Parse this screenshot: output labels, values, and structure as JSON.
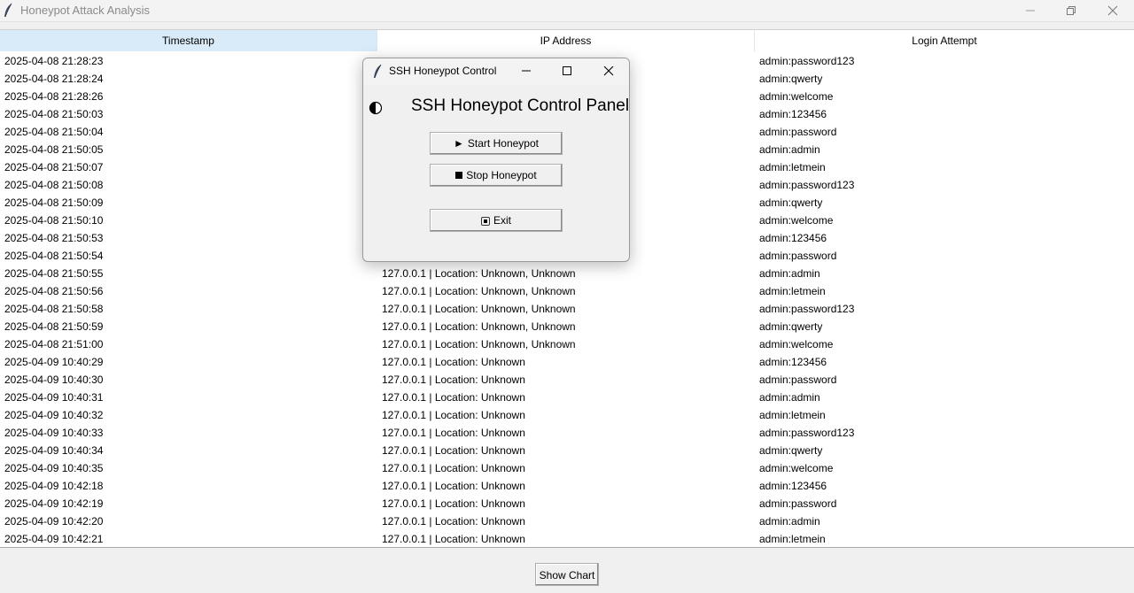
{
  "window": {
    "title": "Honeypot Attack Analysis"
  },
  "table": {
    "columns": [
      "Timestamp",
      "IP Address",
      "Login Attempt"
    ],
    "rows": [
      [
        "2025-04-08 21:28:23",
        "",
        "admin:password123"
      ],
      [
        "2025-04-08 21:28:24",
        "",
        "admin:qwerty"
      ],
      [
        "2025-04-08 21:28:26",
        "",
        "admin:welcome"
      ],
      [
        "2025-04-08 21:50:03",
        "",
        "admin:123456"
      ],
      [
        "2025-04-08 21:50:04",
        "",
        "admin:password"
      ],
      [
        "2025-04-08 21:50:05",
        "",
        "admin:admin"
      ],
      [
        "2025-04-08 21:50:07",
        "",
        "admin:letmein"
      ],
      [
        "2025-04-08 21:50:08",
        "",
        "admin:password123"
      ],
      [
        "2025-04-08 21:50:09",
        "",
        "admin:qwerty"
      ],
      [
        "2025-04-08 21:50:10",
        "",
        "admin:welcome"
      ],
      [
        "2025-04-08 21:50:53",
        "",
        "admin:123456"
      ],
      [
        "2025-04-08 21:50:54",
        "",
        "admin:password"
      ],
      [
        "2025-04-08 21:50:55",
        "127.0.0.1 | Location: Unknown, Unknown",
        "admin:admin"
      ],
      [
        "2025-04-08 21:50:56",
        "127.0.0.1 | Location: Unknown, Unknown",
        "admin:letmein"
      ],
      [
        "2025-04-08 21:50:58",
        "127.0.0.1 | Location: Unknown, Unknown",
        "admin:password123"
      ],
      [
        "2025-04-08 21:50:59",
        "127.0.0.1 | Location: Unknown, Unknown",
        "admin:qwerty"
      ],
      [
        "2025-04-08 21:51:00",
        "127.0.0.1 | Location: Unknown, Unknown",
        "admin:welcome"
      ],
      [
        "2025-04-09 10:40:29",
        "127.0.0.1 | Location: Unknown",
        "admin:123456"
      ],
      [
        "2025-04-09 10:40:30",
        "127.0.0.1 | Location: Unknown",
        "admin:password"
      ],
      [
        "2025-04-09 10:40:31",
        "127.0.0.1 | Location: Unknown",
        "admin:admin"
      ],
      [
        "2025-04-09 10:40:32",
        "127.0.0.1 | Location: Unknown",
        "admin:letmein"
      ],
      [
        "2025-04-09 10:40:33",
        "127.0.0.1 | Location: Unknown",
        "admin:password123"
      ],
      [
        "2025-04-09 10:40:34",
        "127.0.0.1 | Location: Unknown",
        "admin:qwerty"
      ],
      [
        "2025-04-09 10:40:35",
        "127.0.0.1 | Location: Unknown",
        "admin:welcome"
      ],
      [
        "2025-04-09 10:42:18",
        "127.0.0.1 | Location: Unknown",
        "admin:123456"
      ],
      [
        "2025-04-09 10:42:19",
        "127.0.0.1 | Location: Unknown",
        "admin:password"
      ],
      [
        "2025-04-09 10:42:20",
        "127.0.0.1 | Location: Unknown",
        "admin:admin"
      ],
      [
        "2025-04-09 10:42:21",
        "127.0.0.1 | Location: Unknown",
        "admin:letmein"
      ]
    ]
  },
  "bottom": {
    "show_chart_label": "Show Chart"
  },
  "dialog": {
    "title": "SSH Honeypot Control",
    "heading": "SSH Honeypot Control Panel",
    "start_label": "Start Honeypot",
    "stop_label": "Stop Honeypot",
    "exit_label": "Exit",
    "start_glyph": "►"
  },
  "icons": {
    "app": "feather-icon",
    "minimize": "minimize-icon",
    "restore": "restore-icon",
    "maximize": "maximize-icon",
    "close": "close-icon",
    "panel": "half-circle-icon"
  },
  "colors": {
    "header_active": "#d9ebf9",
    "window_bg": "#f0f0f0",
    "table_bg": "#ffffff"
  }
}
